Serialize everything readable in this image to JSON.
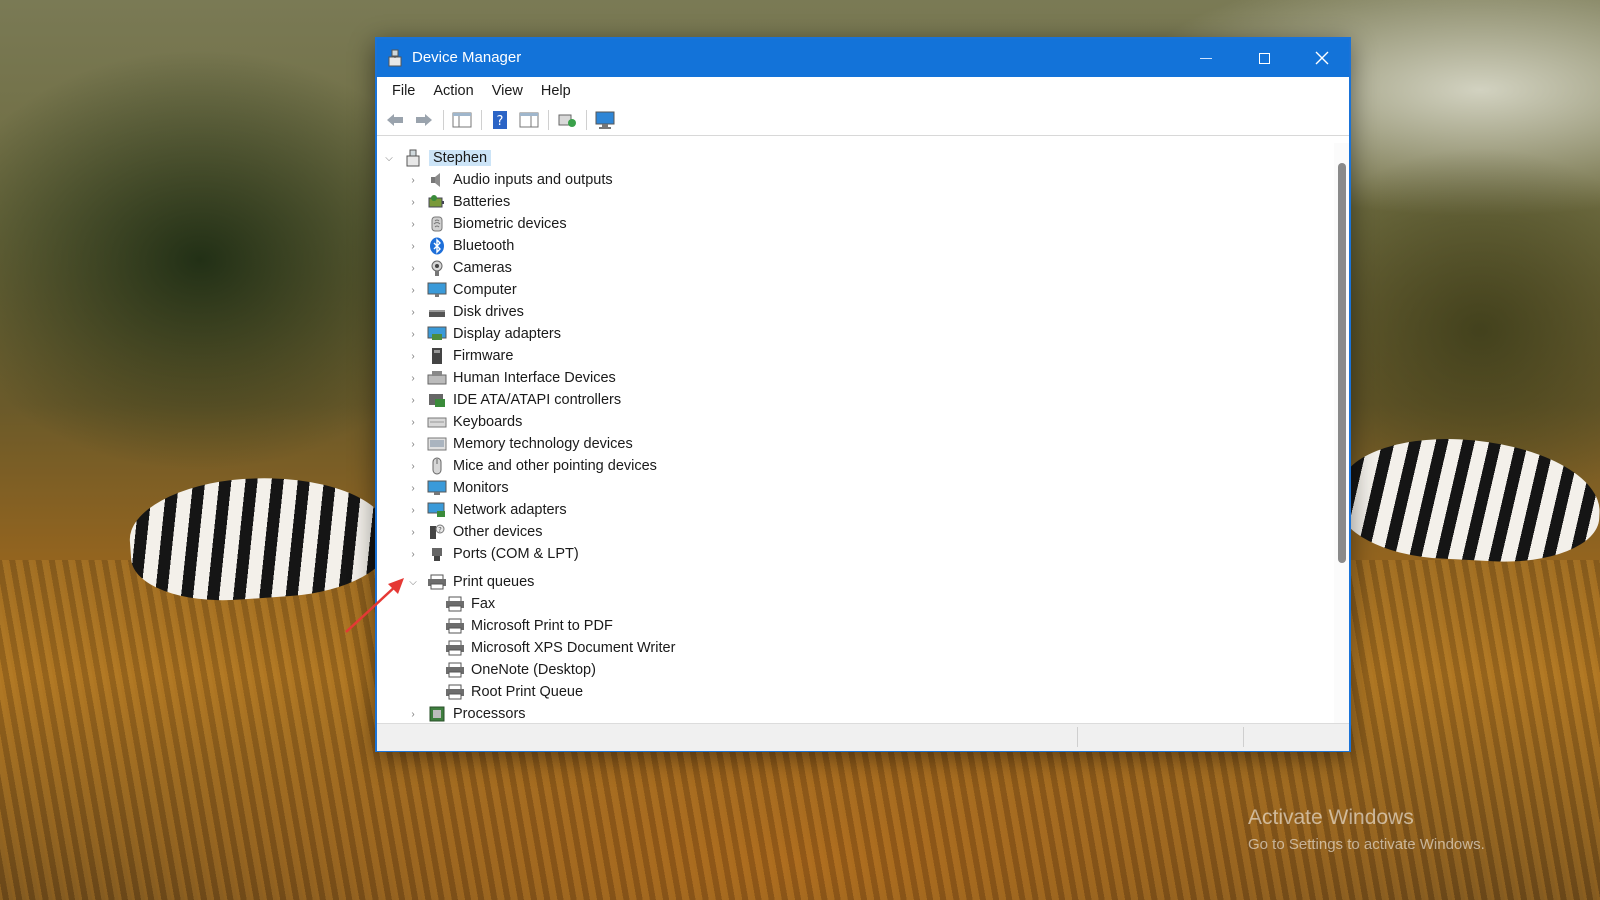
{
  "window": {
    "title": "Device Manager"
  },
  "menu": [
    "File",
    "Action",
    "View",
    "Help"
  ],
  "tree": {
    "root": "Stephen",
    "categories": [
      {
        "label": "Audio inputs and outputs",
        "icon": "speaker-icon"
      },
      {
        "label": "Batteries",
        "icon": "battery-icon"
      },
      {
        "label": "Biometric devices",
        "icon": "fingerprint-icon"
      },
      {
        "label": "Bluetooth",
        "icon": "bluetooth-icon"
      },
      {
        "label": "Cameras",
        "icon": "camera-icon"
      },
      {
        "label": "Computer",
        "icon": "computer-icon"
      },
      {
        "label": "Disk drives",
        "icon": "disk-drive-icon"
      },
      {
        "label": "Display adapters",
        "icon": "display-adapter-icon"
      },
      {
        "label": "Firmware",
        "icon": "firmware-icon"
      },
      {
        "label": "Human Interface Devices",
        "icon": "hid-icon"
      },
      {
        "label": "IDE ATA/ATAPI controllers",
        "icon": "ide-controller-icon"
      },
      {
        "label": "Keyboards",
        "icon": "keyboard-icon"
      },
      {
        "label": "Memory technology devices",
        "icon": "memory-icon"
      },
      {
        "label": "Mice and other pointing devices",
        "icon": "mouse-icon"
      },
      {
        "label": "Monitors",
        "icon": "monitor-icon"
      },
      {
        "label": "Network adapters",
        "icon": "network-adapter-icon"
      },
      {
        "label": "Other devices",
        "icon": "other-devices-icon"
      },
      {
        "label": "Ports (COM & LPT)",
        "icon": "port-icon"
      }
    ],
    "print_queues": {
      "label": "Print queues",
      "children": [
        "Fax",
        "Microsoft Print to PDF",
        "Microsoft XPS Document Writer",
        "OneNote (Desktop)",
        "Root Print Queue"
      ]
    },
    "after": {
      "label": "Processors",
      "icon": "processor-icon"
    }
  },
  "watermark": {
    "line1": "Activate Windows",
    "line2": "Go to Settings to activate Windows."
  },
  "colors": {
    "titlebar": "#1373d9",
    "selection": "#cce4f7",
    "annotation_arrow": "#e53935"
  }
}
